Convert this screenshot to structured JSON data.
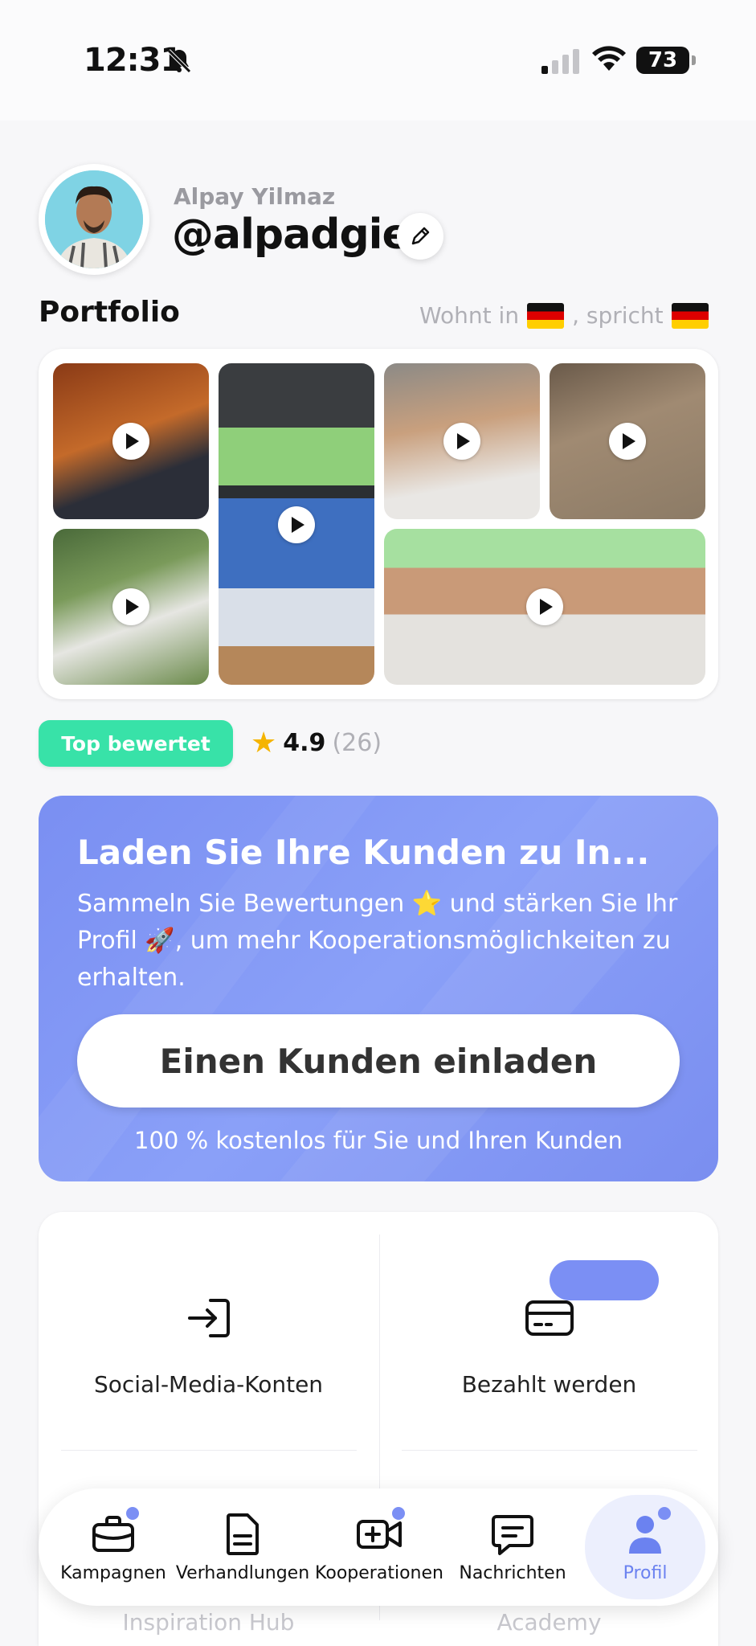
{
  "status_bar": {
    "time": "12:31",
    "battery": "73"
  },
  "profile": {
    "full_name": "Alpay Yilmaz",
    "handle": "@alpadgie",
    "portfolio_title": "Portfolio",
    "lives_in": "Wohnt in",
    "speaks": ", spricht"
  },
  "rating": {
    "badge": "Top bewertet",
    "score": "4.9",
    "count": "(26)"
  },
  "invite": {
    "title": "Laden Sie Ihre Kunden zu In...",
    "text": "Sammeln Sie Bewertungen ⭐ und stärken Sie Ihr Profil 🚀, um mehr Kooperationsmöglichkeiten zu erhalten.",
    "button": "Einen Kunden einladen",
    "footer": "100 % kostenlos für Sie und Ihren Kunden"
  },
  "actions": {
    "social": "Social-Media-Konten",
    "paid": "Bezahlt werden",
    "inspiration": "Inspiration Hub",
    "academy": "Academy"
  },
  "tabs": {
    "campaigns": "Kampagnen",
    "negotiations": "Verhandlungen",
    "cooperations": "Kooperationen",
    "messages": "Nachrichten",
    "profile": "Profil"
  },
  "colors": {
    "accent": "#7b8ff4",
    "badge": "#38e2a8",
    "banner": "#8aa0f8"
  }
}
